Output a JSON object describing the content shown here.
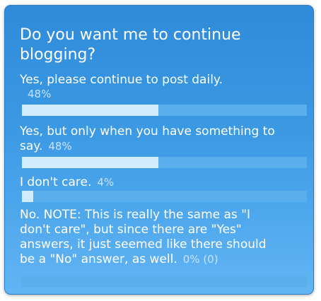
{
  "poll": {
    "question": "Do you want me to continue blogging?",
    "options": [
      {
        "label": "Yes, please continue to post daily.",
        "percent_label": "48%",
        "value": 0.48
      },
      {
        "label_line1": "Yes, but only when you have something to",
        "label_line2": "say.",
        "percent_label": "48%",
        "value": 0.48
      },
      {
        "label": "I don't care.",
        "percent_label": "4%",
        "value": 0.04
      },
      {
        "label_line1": "No. NOTE: This is really the same as \"I",
        "label_line2": "don't care\", but since there are \"Yes\"",
        "label_line3": "answers, it just seemed like there should",
        "label_line4": "be a \"No\" answer, as well.",
        "percent_label": "0% (0)",
        "value": 0.0
      }
    ]
  },
  "colors": {
    "panel_top": "#2f8bd9",
    "panel_bottom": "#63b5f4",
    "bar_fill": "#d2ecff",
    "bar_track": "#5aaeeb",
    "text": "#ffffff",
    "percent_text": "#c6e4ff"
  }
}
